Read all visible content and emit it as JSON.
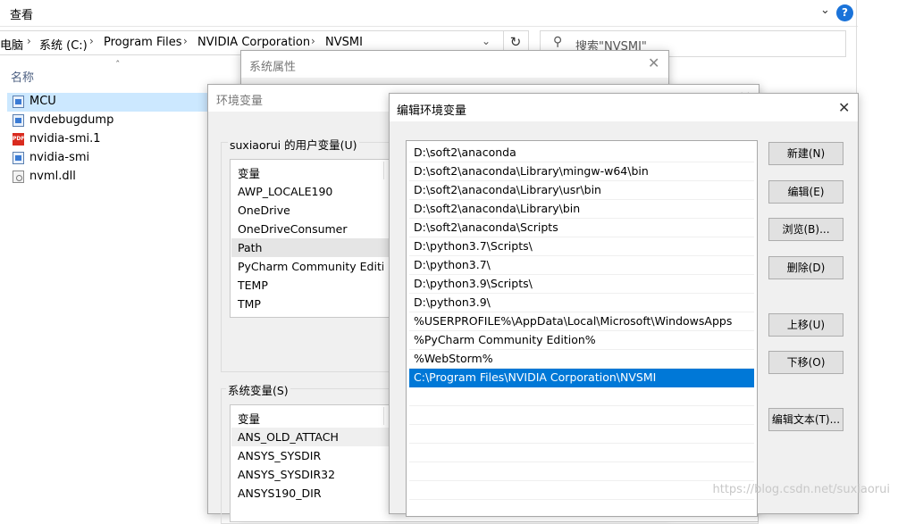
{
  "explorer": {
    "ribbon_tab": "查看",
    "breadcrumb": [
      "电脑",
      "系统 (C:)",
      "Program Files",
      "NVIDIA Corporation",
      "NVSMI"
    ],
    "search_placeholder": "搜索\"NVSMI\"",
    "column_name": "名称",
    "files": [
      {
        "name": "MCU",
        "icon": "exe-icon",
        "selected": true
      },
      {
        "name": "nvdebugdump",
        "icon": "exe-icon"
      },
      {
        "name": "nvidia-smi.1",
        "icon": "pdf-icon"
      },
      {
        "name": "nvidia-smi",
        "icon": "exe-icon"
      },
      {
        "name": "nvml.dll",
        "icon": "dll-icon"
      }
    ]
  },
  "system_properties": {
    "title": "系统属性"
  },
  "env_vars": {
    "title": "环境变量",
    "user_group_label": "suxiaorui 的用户变量(U)",
    "user_col_header": "变量",
    "user_vars": [
      "AWP_LOCALE190",
      "OneDrive",
      "OneDriveConsumer",
      "Path",
      "PyCharm Community Editi...",
      "TEMP",
      "TMP"
    ],
    "system_group_label": "系统变量(S)",
    "system_col_header": "变量",
    "system_vars": [
      "ANS_OLD_ATTACH",
      "ANSYS_SYSDIR",
      "ANSYS_SYSDIR32",
      "ANSYS190_DIR"
    ]
  },
  "edit_env": {
    "title": "编辑环境变量",
    "paths": [
      "D:\\soft2\\anaconda",
      "D:\\soft2\\anaconda\\Library\\mingw-w64\\bin",
      "D:\\soft2\\anaconda\\Library\\usr\\bin",
      "D:\\soft2\\anaconda\\Library\\bin",
      "D:\\soft2\\anaconda\\Scripts",
      "D:\\python3.7\\Scripts\\",
      "D:\\python3.7\\",
      "D:\\python3.9\\Scripts\\",
      "D:\\python3.9\\",
      "%USERPROFILE%\\AppData\\Local\\Microsoft\\WindowsApps",
      "%PyCharm Community Edition%",
      "%WebStorm%",
      "C:\\Program Files\\NVIDIA Corporation\\NVSMI"
    ],
    "selected_index": 12,
    "buttons": {
      "new": "新建(N)",
      "edit": "编辑(E)",
      "browse": "浏览(B)...",
      "delete": "删除(D)",
      "move_up": "上移(U)",
      "move_down": "下移(O)",
      "edit_text": "编辑文本(T)..."
    }
  },
  "watermark": "https://blog.csdn.net/suxiaorui",
  "colors": {
    "selection": "#0078d7",
    "explorer_selection": "#cce8ff",
    "dialog_bg": "#f0f0f0"
  }
}
